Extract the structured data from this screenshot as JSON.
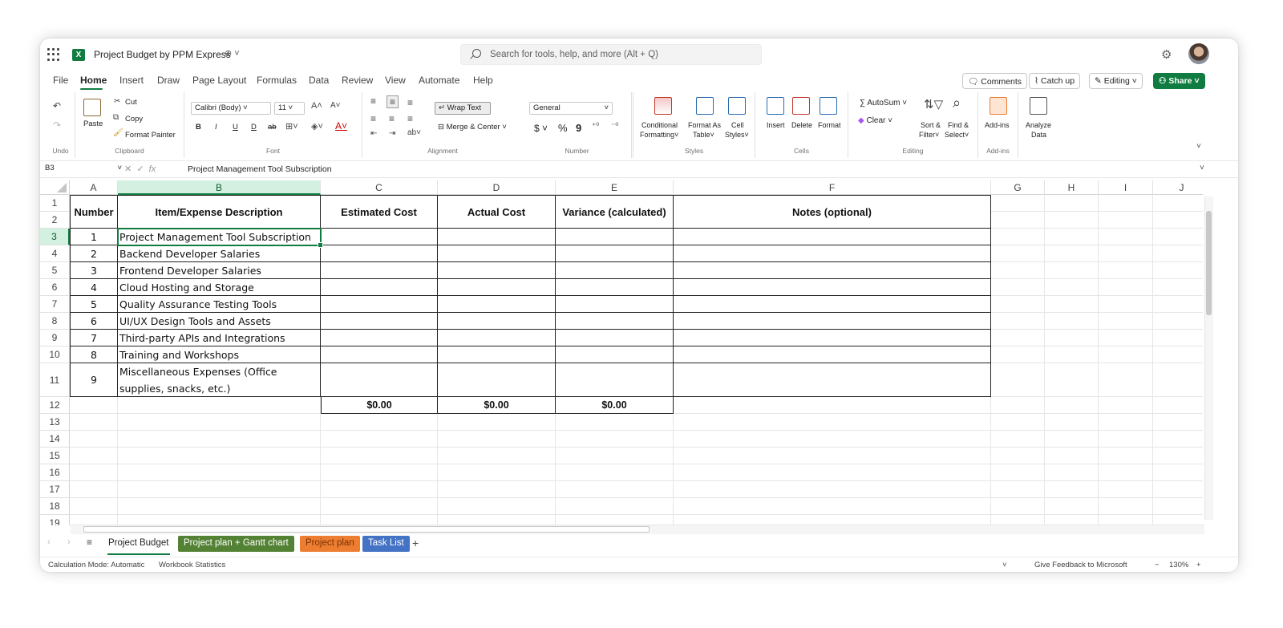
{
  "app": {
    "title": "Project Budget by PPM Express",
    "title_icons": "⊕ ˅",
    "search_placeholder": "Search for tools, help, and more (Alt + Q)"
  },
  "menu": [
    "File",
    "Home",
    "Insert",
    "Draw",
    "Page Layout",
    "Formulas",
    "Data",
    "Review",
    "View",
    "Automate",
    "Help"
  ],
  "menu_active": "Home",
  "top_buttons": {
    "comments": "Comments",
    "catchup": "Catch up",
    "editing": "Editing",
    "share": "Share"
  },
  "ribbon": {
    "undo": {
      "label": "Undo"
    },
    "clipboard": {
      "label": "Clipboard",
      "paste": "Paste",
      "cut": "Cut",
      "copy": "Copy",
      "format_painter": "Format Painter"
    },
    "font": {
      "label": "Font",
      "family": "Calibri (Body)",
      "size": "11",
      "bold": "B",
      "italic": "I",
      "underline": "U",
      "double_underline": "D",
      "strike": "ab"
    },
    "alignment": {
      "label": "Alignment",
      "wrap": "Wrap Text",
      "merge": "Merge & Center"
    },
    "number": {
      "label": "Number",
      "format": "General",
      "currency": "$",
      "percent": "%",
      "comma": "9"
    },
    "styles": {
      "label": "Styles",
      "conditional": "Conditional",
      "conditional2": "Formatting",
      "format_as": "Format As",
      "table": "Table",
      "cell": "Cell",
      "cell_styles": "Styles"
    },
    "cells": {
      "label": "Cells",
      "insert": "Insert",
      "delete": "Delete",
      "format": "Format"
    },
    "editing": {
      "label": "Editing",
      "autosum": "AutoSum",
      "clear": "Clear",
      "sort": "Sort &",
      "filter": "Filter",
      "find": "Find &",
      "select": "Select"
    },
    "addins": {
      "label": "Add-ins",
      "addins": "Add-ins"
    },
    "analyze": {
      "analyze": "Analyze",
      "data": "Data"
    }
  },
  "formula_bar": {
    "cell_ref": "B3",
    "fx": "fx",
    "content": "Project Management Tool Subscription"
  },
  "columns": [
    "A",
    "B",
    "C",
    "D",
    "E",
    "F",
    "G",
    "H",
    "I",
    "J"
  ],
  "rows": [
    "1",
    "2",
    "3",
    "4",
    "5",
    "6",
    "7",
    "8",
    "9",
    "10",
    "11",
    "12",
    "13",
    "14",
    "15",
    "16",
    "17",
    "18",
    "19"
  ],
  "table": {
    "headers": [
      "Number",
      "Item/Expense Description",
      "Estimated Cost",
      "Actual Cost",
      "Variance (calculated)",
      "Notes (optional)"
    ],
    "items": [
      {
        "num": "1",
        "desc": "Project Management Tool Subscription"
      },
      {
        "num": "2",
        "desc": "Backend Developer Salaries"
      },
      {
        "num": "3",
        "desc": "Frontend Developer Salaries"
      },
      {
        "num": "4",
        "desc": "Cloud Hosting and Storage"
      },
      {
        "num": "5",
        "desc": "Quality Assurance Testing Tools"
      },
      {
        "num": "6",
        "desc": "UI/UX Design Tools and Assets"
      },
      {
        "num": "7",
        "desc": "Third-party APIs and Integrations"
      },
      {
        "num": "8",
        "desc": "Training and Workshops"
      },
      {
        "num": "9",
        "desc": "Miscellaneous Expenses (Office supplies, snacks, etc.)"
      }
    ],
    "totals": [
      "$0.00",
      "$0.00",
      "$0.00"
    ]
  },
  "sheet_tabs": [
    {
      "label": "Project Budget",
      "color": "#ffffff",
      "text": "#242424"
    },
    {
      "label": "Project plan + Gantt chart",
      "color": "#548235",
      "text": "#ffffff"
    },
    {
      "label": "Project plan",
      "color": "#ed7d31",
      "text": "#7a3200"
    },
    {
      "label": "Task List",
      "color": "#4472c4",
      "text": "#ffffff"
    }
  ],
  "status": {
    "calc_mode": "Calculation Mode: Automatic",
    "workbook_stats": "Workbook Statistics",
    "feedback": "Give Feedback to Microsoft",
    "zoom": "130%"
  },
  "colors": {
    "accent": "#107c41",
    "selection": "#d3f0e0"
  }
}
